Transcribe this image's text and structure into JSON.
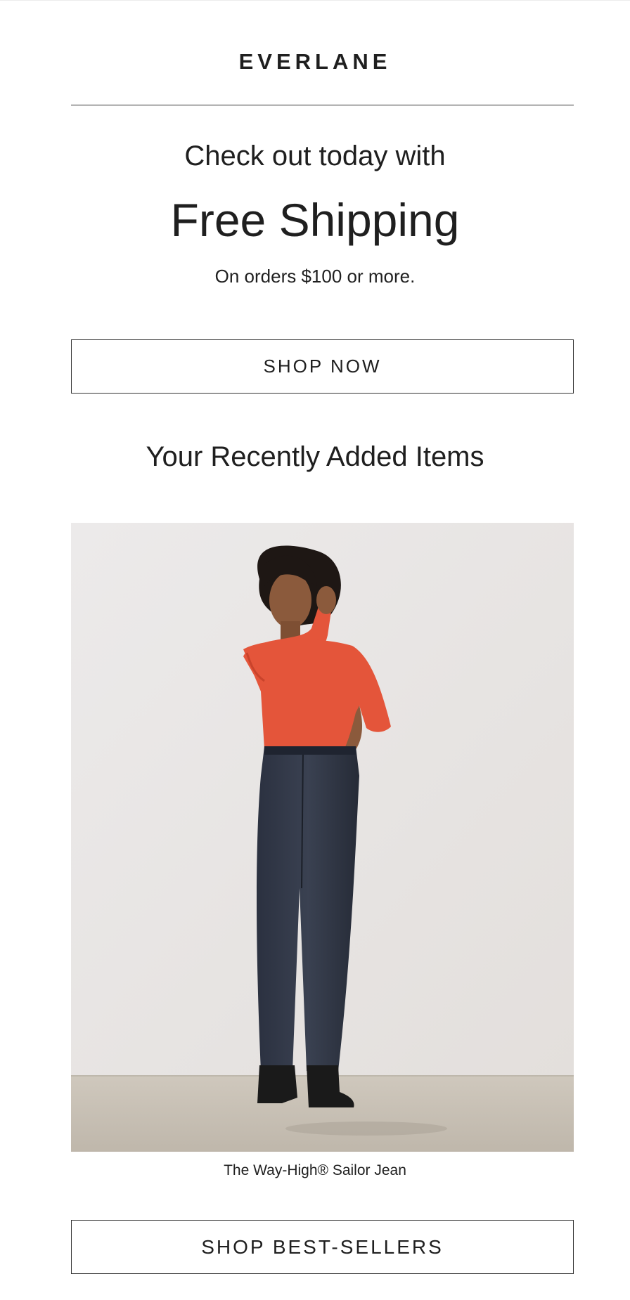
{
  "header": {
    "brand": "EVERLANE"
  },
  "promo": {
    "line1": "Check out today with",
    "headline": "Free Shipping",
    "condition": "On orders $100 or more."
  },
  "cta_primary": "SHOP NOW",
  "recent": {
    "title": "Your Recently Added Items",
    "items": [
      {
        "name": "The Way-High® Sailor Jean"
      }
    ]
  },
  "cta_secondary": "SHOP BEST-SELLERS"
}
